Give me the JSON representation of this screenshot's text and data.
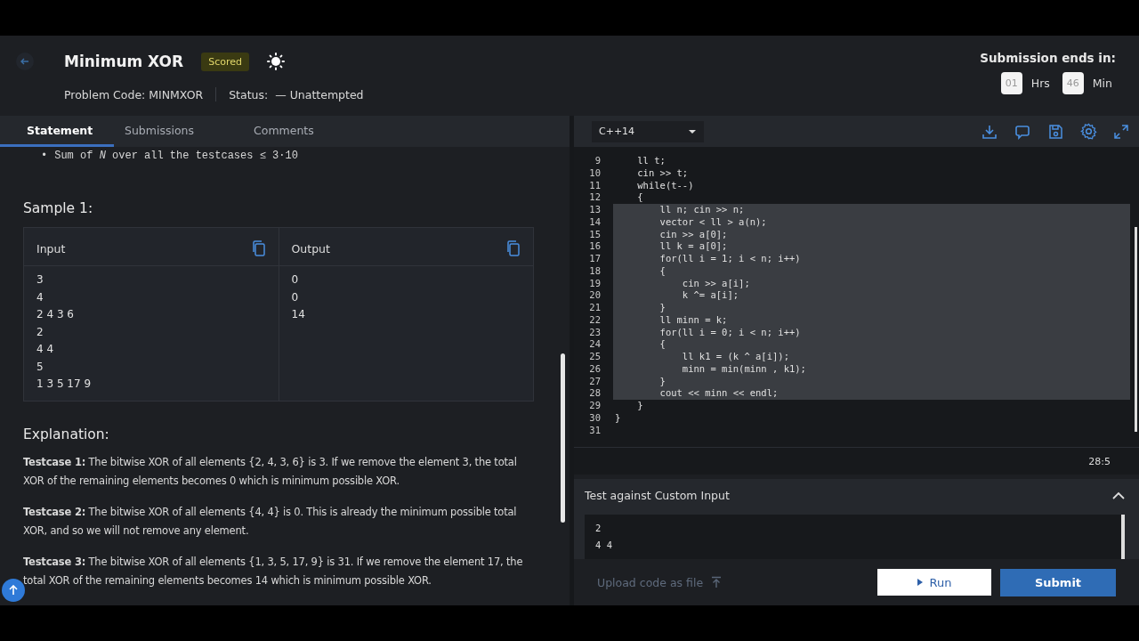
{
  "header": {
    "title": "Minimum XOR",
    "badge": "Scored",
    "problem_code": "Problem Code: MINMXOR",
    "status_label": "Status:",
    "status_value": "— Unattempted"
  },
  "timer": {
    "label": "Submission ends in:",
    "hours": "01",
    "hours_unit": "Hrs",
    "minutes": "46",
    "minutes_unit": "Min"
  },
  "tabs": [
    {
      "label": "Statement",
      "selected": true
    },
    {
      "label": "Submissions",
      "selected": false
    },
    {
      "label": "Comments",
      "selected": false
    }
  ],
  "statement": {
    "bullet": "•",
    "constraint": "Sum of *N* over all the testcases ≤ 3·10",
    "sample_title": "Sample 1:",
    "input_heading": "Input",
    "output_heading": "Output",
    "input_lines": [
      "3",
      "4",
      "2 4 3 6",
      "2",
      "4 4",
      "5",
      "1 3 5 17 9"
    ],
    "output_lines": [
      "0",
      "0",
      "14"
    ],
    "explanation_title": "Explanation:",
    "paragraphs": [
      "**Testcase 1:** The bitwise XOR of all elements {2, 4, 3, 6} is 3. If we remove the element 3, the total XOR of the remaining elements becomes 0 which is minimum possible XOR.",
      "**Testcase 2:** The bitwise XOR of all elements {4, 4} is 0. This is already the minimum possible total XOR, and so we will not remove any element.",
      "**Testcase 3:** The bitwise XOR of all elements {1, 3, 5, 17, 9} is 31. If we remove the element 17, the total XOR of the remaining elements becomes 14 which is minimum possible XOR."
    ]
  },
  "editor": {
    "language": "C++14",
    "cursor": "28:5",
    "lines": [
      {
        "number": "9",
        "code": "    ll t;",
        "selected": false
      },
      {
        "number": "10",
        "code": "    cin >> t;",
        "selected": false
      },
      {
        "number": "11",
        "code": "    while(t--)",
        "selected": false
      },
      {
        "number": "12",
        "code": "    {",
        "selected": false
      },
      {
        "number": "13",
        "code": "        ll n; cin >> n;",
        "selected": true
      },
      {
        "number": "14",
        "code": "        vector < ll > a(n);",
        "selected": true
      },
      {
        "number": "15",
        "code": "        cin >> a[0];",
        "selected": true
      },
      {
        "number": "16",
        "code": "        ll k = a[0];",
        "selected": true
      },
      {
        "number": "17",
        "code": "        for(ll i = 1; i < n; i++)",
        "selected": true
      },
      {
        "number": "18",
        "code": "        {",
        "selected": true
      },
      {
        "number": "19",
        "code": "            cin >> a[i];",
        "selected": true
      },
      {
        "number": "20",
        "code": "            k ^= a[i];",
        "selected": true
      },
      {
        "number": "21",
        "code": "        }",
        "selected": true
      },
      {
        "number": "22",
        "code": "        ll minn = k;",
        "selected": true
      },
      {
        "number": "23",
        "code": "        for(ll i = 0; i < n; i++)",
        "selected": true
      },
      {
        "number": "24",
        "code": "        {",
        "selected": true
      },
      {
        "number": "25",
        "code": "            ll k1 = (k ^ a[i]);",
        "selected": true
      },
      {
        "number": "26",
        "code": "            minn = min(minn , k1);",
        "selected": true
      },
      {
        "number": "27",
        "code": "        }",
        "selected": true
      },
      {
        "number": "28",
        "code": "        cout << minn << endl;",
        "selected": true
      },
      {
        "number": "29",
        "code": "    }",
        "selected": false
      },
      {
        "number": "30",
        "code": "}",
        "selected": false
      },
      {
        "number": "31",
        "selected": false
      }
    ]
  },
  "custom_input": {
    "title": "Test against Custom Input",
    "expanded": true,
    "lines": [
      "2",
      "4 4"
    ]
  },
  "footer": {
    "upload": "Upload code as file",
    "run": "Run",
    "submit": "Submit"
  }
}
